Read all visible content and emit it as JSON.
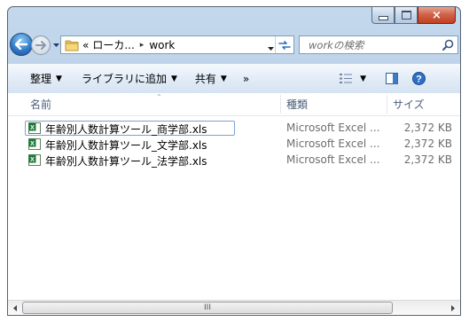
{
  "window": {
    "buttons": {
      "minimize": "minimize-icon",
      "maximize": "maximize-icon",
      "close": "×"
    }
  },
  "navigation": {
    "back_icon": "back-arrow-icon",
    "forward_icon": "forward-arrow-icon",
    "address": {
      "overflow": "«",
      "crumbs": [
        "ローカ...",
        "work"
      ],
      "separator": "▸"
    },
    "search": {
      "placeholder": "workの検索"
    }
  },
  "toolbar": {
    "organize": "整理",
    "add_to_library": "ライブラリに追加",
    "share": "共有",
    "more": "»"
  },
  "columns": {
    "name": "名前",
    "type": "種類",
    "size": "サイズ"
  },
  "files": [
    {
      "name": "年齢別人数計算ツール_商学部.xls",
      "type": "Microsoft Excel ...",
      "size": "2,372 KB",
      "selected": true
    },
    {
      "name": "年齢別人数計算ツール_文学部.xls",
      "type": "Microsoft Excel ...",
      "size": "2,372 KB",
      "selected": false
    },
    {
      "name": "年齢別人数計算ツール_法学部.xls",
      "type": "Microsoft Excel ...",
      "size": "2,372 KB",
      "selected": false
    }
  ],
  "scrollbar": {
    "grip": "III"
  },
  "colors": {
    "accent": "#2d78c6",
    "selection_border": "#7da2ce",
    "excel_green": "#1f7a3a"
  }
}
